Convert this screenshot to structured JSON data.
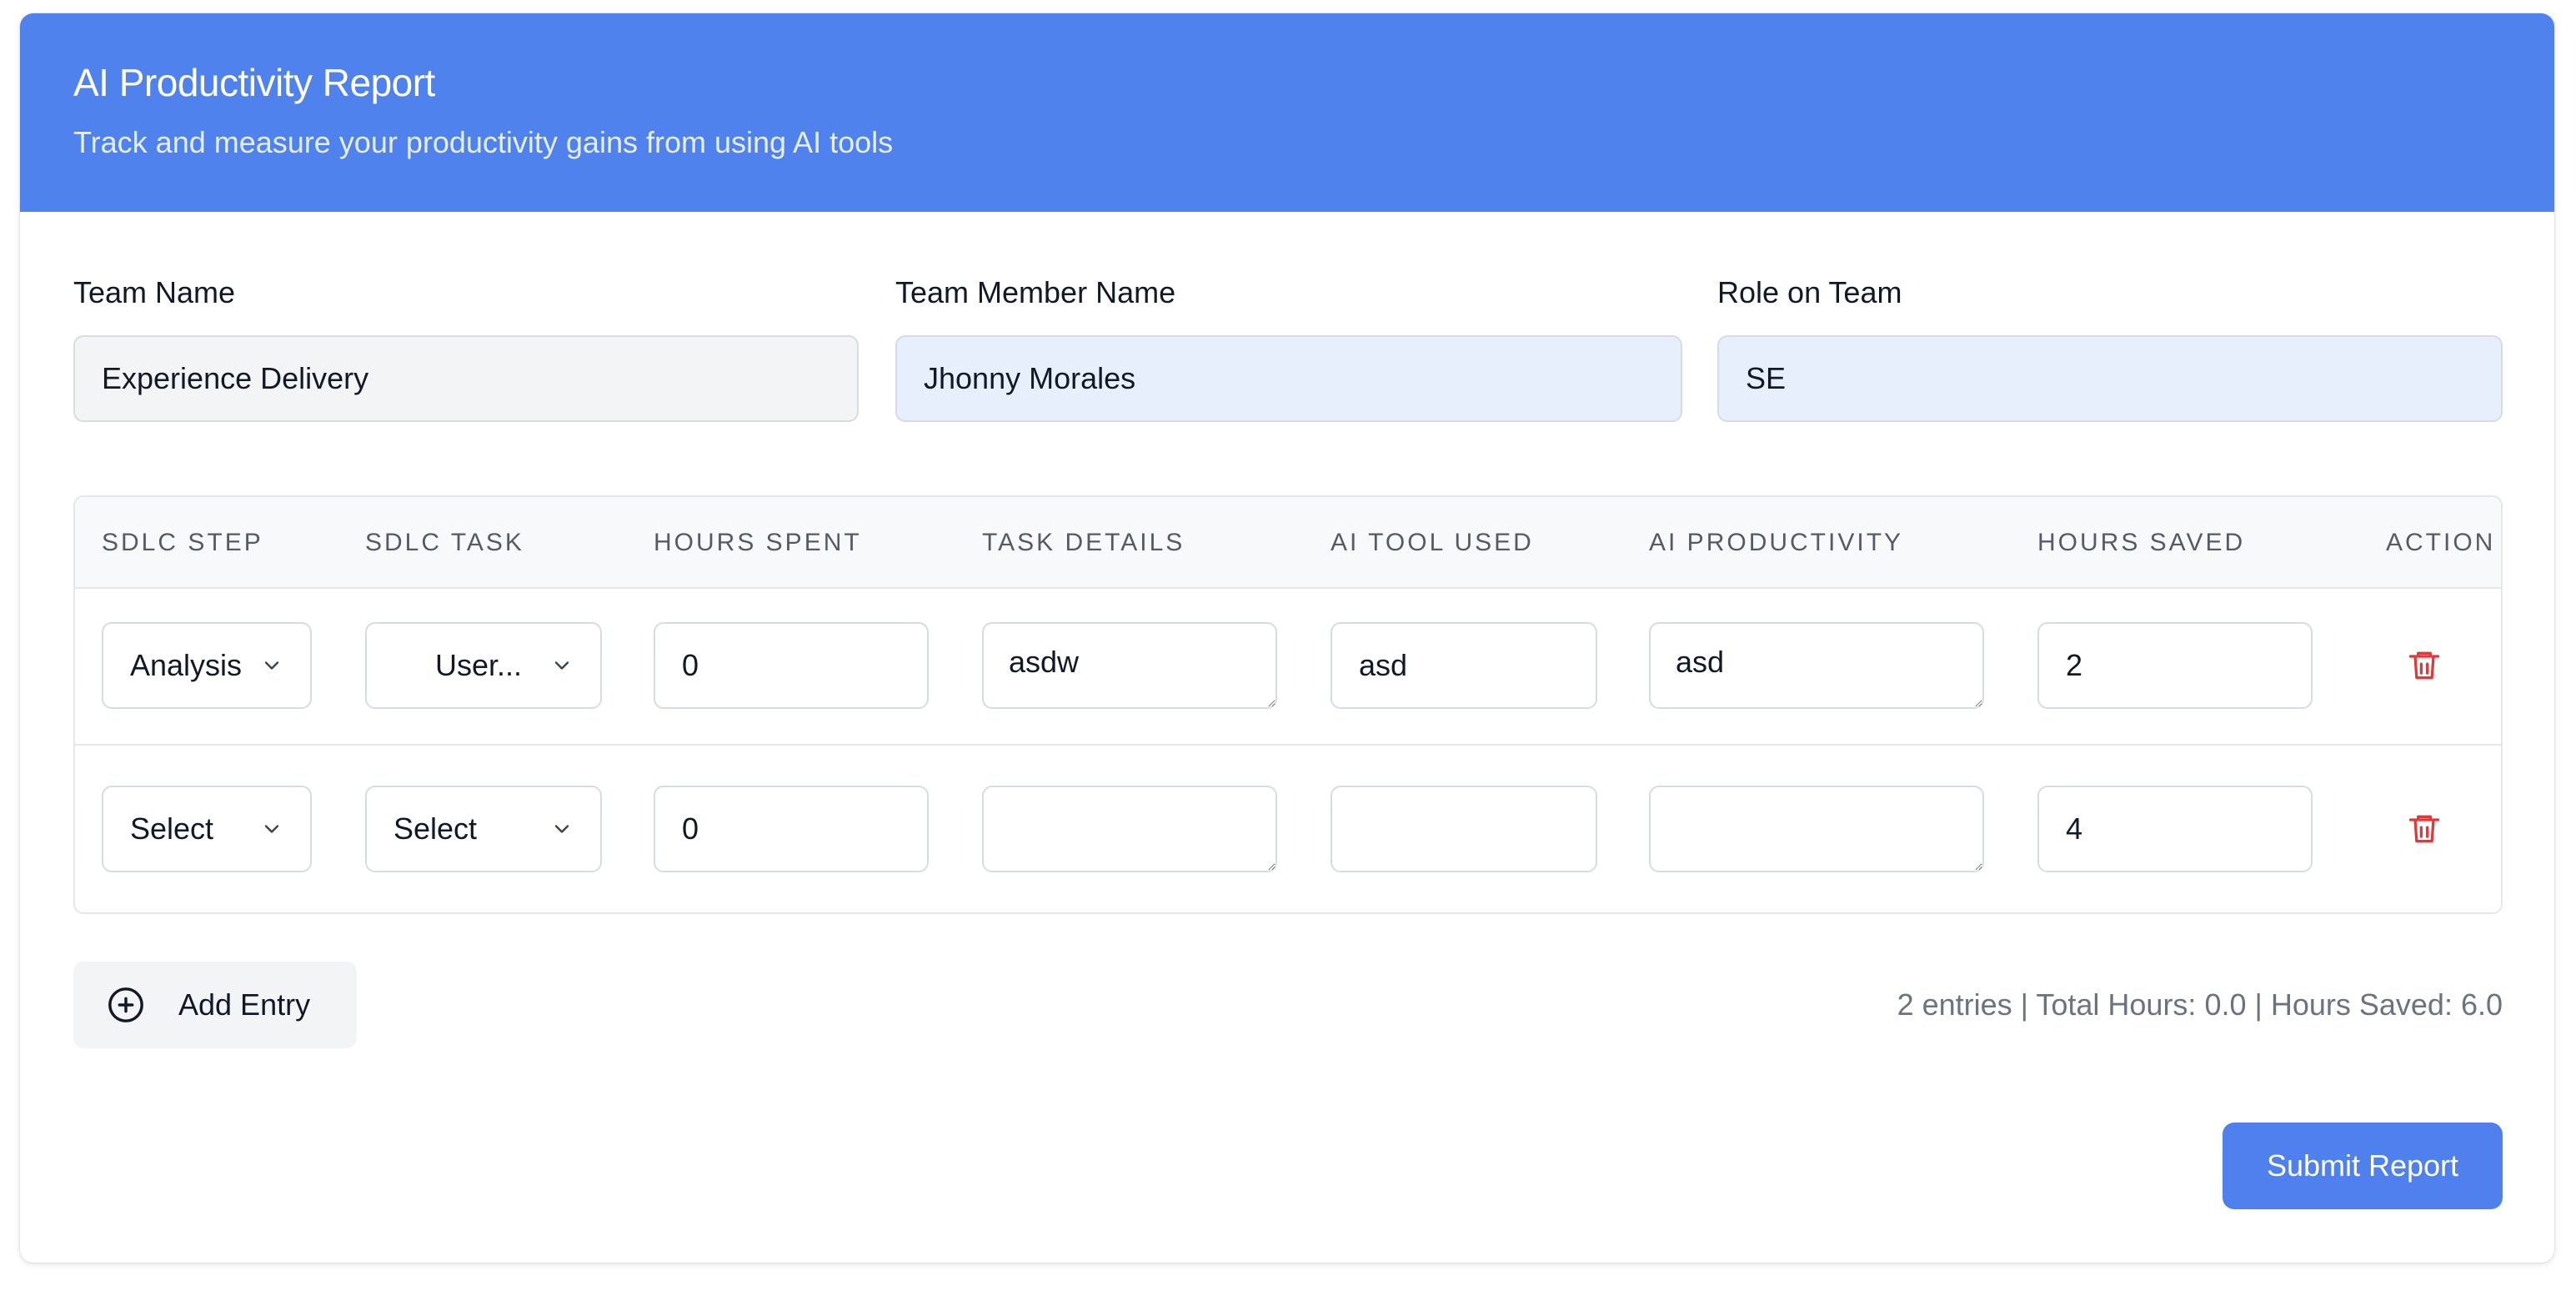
{
  "header": {
    "title": "AI Productivity Report",
    "subtitle": "Track and measure your productivity gains from using AI tools"
  },
  "fields": {
    "team_name": {
      "label": "Team Name",
      "value": "Experience Delivery"
    },
    "member_name": {
      "label": "Team Member Name",
      "value": "Jhonny Morales"
    },
    "role": {
      "label": "Role on Team",
      "value": "SE"
    }
  },
  "table": {
    "headers": [
      "SDLC STEP",
      "SDLC TASK",
      "HOURS SPENT",
      "TASK DETAILS",
      "AI TOOL USED",
      "AI PRODUCTIVITY",
      "HOURS SAVED",
      "ACTION"
    ],
    "rows": [
      {
        "step": "Analysis",
        "task": "User...",
        "hours_spent": "0",
        "task_details": "asdw",
        "ai_tool": "asd",
        "ai_productivity": "asd",
        "hours_saved": "2"
      },
      {
        "step": "Select",
        "task": "Select",
        "hours_spent": "0",
        "task_details": "",
        "ai_tool": "",
        "ai_productivity": "",
        "hours_saved": "4"
      }
    ]
  },
  "footer": {
    "add_entry_label": "Add Entry",
    "summary": "2 entries | Total Hours: 0.0 | Hours Saved: 6.0",
    "submit_label": "Submit Report"
  },
  "icons": {
    "chevron": "chevron-down-icon",
    "trash": "trash-icon",
    "add": "plus-circle-icon"
  },
  "colors": {
    "header_bg": "#5082ee",
    "accent": "#4f80ee",
    "danger": "#dc3b3b"
  }
}
